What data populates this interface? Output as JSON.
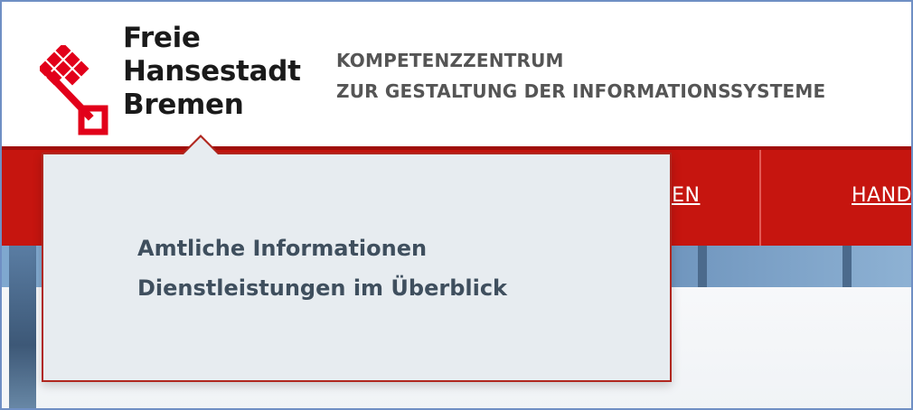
{
  "header": {
    "logo": {
      "line1": "Freie",
      "line2": "Hansestadt",
      "line3": "Bremen",
      "icon": "bremen-key-icon",
      "color": "#e2001a"
    },
    "org_title": {
      "line1": "KOMPETENZZENTRUM",
      "line2": "ZUR GESTALTUNG DER INFORMATIONSSYSTEME"
    }
  },
  "navbar": {
    "color": "#c6150f",
    "items": [
      {
        "label": "UNGEN"
      },
      {
        "label": "HAND"
      }
    ]
  },
  "popover": {
    "links": [
      {
        "label": "Amtliche Informationen"
      },
      {
        "label": "Dienstleistungen im Überblick"
      }
    ]
  }
}
